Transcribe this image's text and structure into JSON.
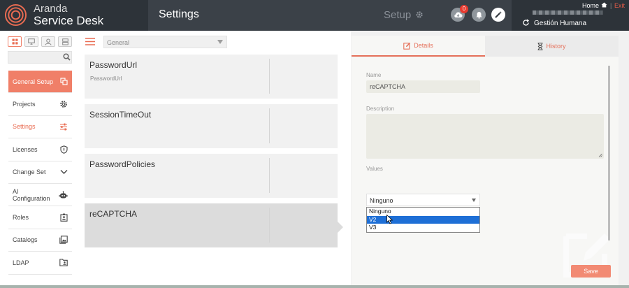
{
  "brand": {
    "line1": "Aranda",
    "line2": "Service Desk"
  },
  "header": {
    "page_title": "Settings",
    "section_label": "Setup",
    "notification_count": "0",
    "home_label": "Home",
    "exit_label": "Exit",
    "organization": "Gestión Humana"
  },
  "sidebar": {
    "items": [
      {
        "label": "General Setup",
        "icon": "copy-icon"
      },
      {
        "label": "Projects",
        "icon": "gear-icon"
      },
      {
        "label": "Settings",
        "icon": "sliders-icon"
      },
      {
        "label": "Licenses",
        "icon": "shield-icon"
      },
      {
        "label": "Change Set",
        "icon": "chevron-down-icon"
      },
      {
        "label": "AI Configuration",
        "icon": "robot-icon"
      },
      {
        "label": "Roles",
        "icon": "id-badge-icon"
      },
      {
        "label": "Catalogs",
        "icon": "images-icon"
      },
      {
        "label": "LDAP",
        "icon": "folder-user-icon"
      }
    ]
  },
  "filter": {
    "selected": "General"
  },
  "settings_list": [
    {
      "name": "PasswordUrl",
      "sub": "PasswordUrl"
    },
    {
      "name": "SessionTimeOut",
      "sub": ""
    },
    {
      "name": "PasswordPolicies",
      "sub": ""
    },
    {
      "name": "reCAPTCHA",
      "sub": ""
    }
  ],
  "detail": {
    "tabs": {
      "details": "Details",
      "history": "History"
    },
    "name_label": "Name",
    "name_value": "reCAPTCHA",
    "description_label": "Description",
    "description_value": "",
    "values_label": "Values",
    "values_selected": "Ninguno",
    "options": [
      "Ninguno",
      "V2",
      "V3"
    ],
    "save_label": "Save"
  },
  "colors": {
    "accent": "#f07f68",
    "topbar": "#2d3339",
    "dropdown_hover": "#1e6fd6"
  }
}
